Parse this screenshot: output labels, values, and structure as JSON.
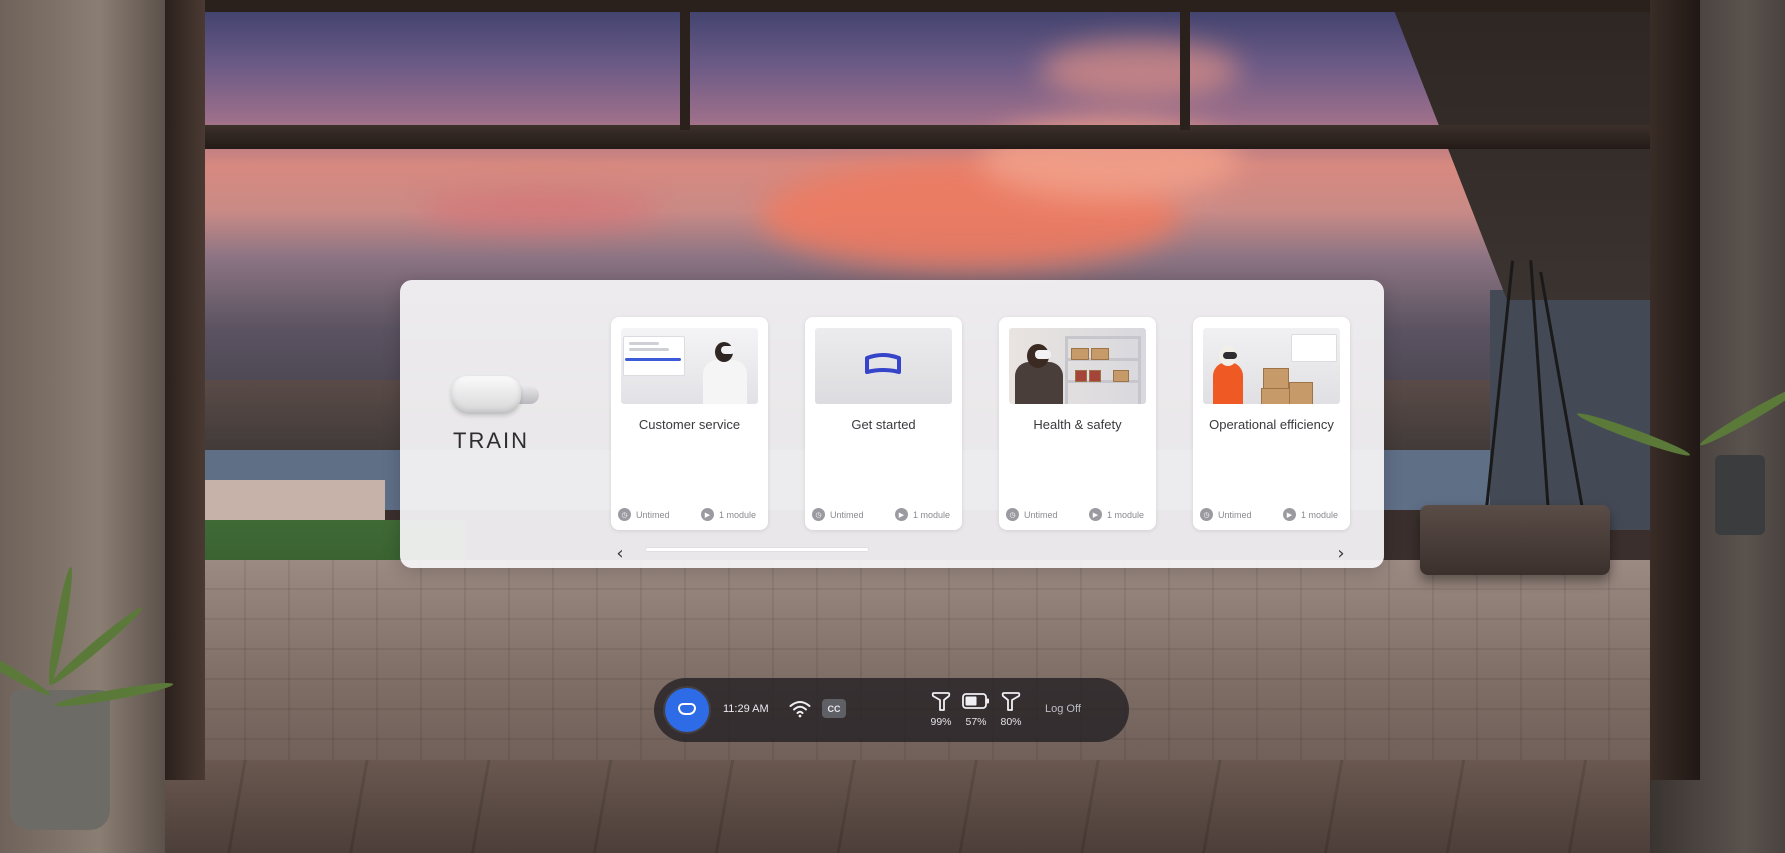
{
  "panel": {
    "brand_label": "TRAIN",
    "cards": [
      {
        "title": "Customer service",
        "duration": "Untimed",
        "modules": "1 module"
      },
      {
        "title": "Get started",
        "duration": "Untimed",
        "modules": "1 module"
      },
      {
        "title": "Health & safety",
        "duration": "Untimed",
        "modules": "1 module"
      },
      {
        "title": "Operational efficiency",
        "duration": "Untimed",
        "modules": "1 module"
      }
    ],
    "prev_glyph": "‹",
    "next_glyph": "›",
    "scroll_position": 0
  },
  "taskbar": {
    "time": "11:29 AM",
    "cc_label": "CC",
    "left_controller": "99%",
    "headset_battery": "57%",
    "right_controller": "80%",
    "logoff_label": "Log Off"
  },
  "icons": {
    "home": "headset-home-icon",
    "wifi": "wifi-icon",
    "duration": "clock-icon",
    "modules": "play-icon"
  },
  "colors": {
    "accent": "#2e6be6",
    "panel_bg": "#f6f5f7",
    "taskbar_bg": "#262226"
  }
}
